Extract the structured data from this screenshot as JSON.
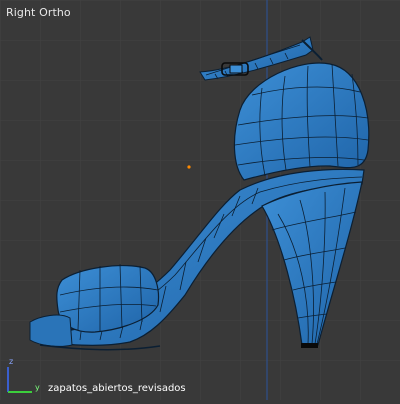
{
  "viewport": {
    "view_label": "Right Ortho",
    "object_name": "zapatos_abiertos_revisados",
    "axes": {
      "z_label": "z",
      "y_label": "y"
    },
    "model": {
      "name": "shoe-mesh",
      "selected": true
    },
    "colors": {
      "background": "#393939",
      "grid": "#444444",
      "mesh_fill": "#2f7fc4",
      "mesh_wire": "#0b1f33",
      "z_axis": "#3a5fcd",
      "y_axis": "#3ccf3c",
      "origin": "#ff8a00"
    }
  }
}
